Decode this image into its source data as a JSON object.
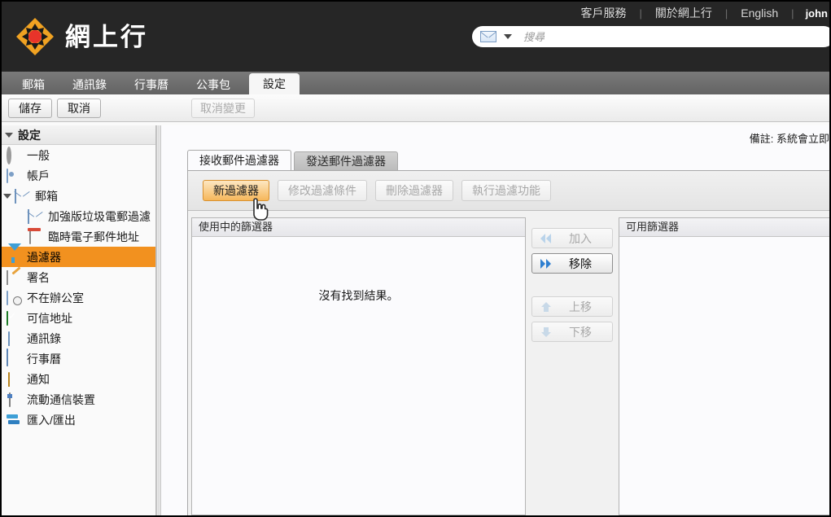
{
  "header": {
    "brand_name": "網上行",
    "util_links": [
      "客戶服務",
      "關於網上行",
      "English"
    ],
    "separator": "|",
    "user_name": "john",
    "search": {
      "placeholder": "搜尋",
      "value": "",
      "mail_icon": "envelope-icon",
      "dropdown_icon": "chevron-down-icon"
    }
  },
  "main_tabs": [
    {
      "label": "郵箱",
      "active": false
    },
    {
      "label": "通訊錄",
      "active": false
    },
    {
      "label": "行事曆",
      "active": false
    },
    {
      "label": "公事包",
      "active": false
    },
    {
      "label": "設定",
      "active": true
    }
  ],
  "toolbar": {
    "save_label": "儲存",
    "cancel_label": "取消",
    "revert_label": "取消變更"
  },
  "sidebar": {
    "section_title": "設定",
    "items": [
      {
        "label": "一般",
        "icon": "gear-icon",
        "indent": 0,
        "selected": false
      },
      {
        "label": "帳戶",
        "icon": "account-icon",
        "indent": 0,
        "selected": false
      },
      {
        "label": "郵箱",
        "icon": "envelope-icon",
        "indent": 0,
        "selected": false,
        "expander": true
      },
      {
        "label": "加強版垃圾電郵過濾",
        "icon": "envelope-icon",
        "indent": 2,
        "selected": false
      },
      {
        "label": "臨時電子郵件地址",
        "icon": "trash-icon",
        "indent": 2,
        "selected": false
      },
      {
        "label": "過濾器",
        "icon": "funnel-icon",
        "indent": 0,
        "selected": true
      },
      {
        "label": "署名",
        "icon": "signature-icon",
        "indent": 0,
        "selected": false
      },
      {
        "label": "不在辦公室",
        "icon": "out-of-office-icon",
        "indent": 0,
        "selected": false
      },
      {
        "label": "可信地址",
        "icon": "shield-check-icon",
        "indent": 0,
        "selected": false
      },
      {
        "label": "通訊錄",
        "icon": "person-icon",
        "indent": 0,
        "selected": false
      },
      {
        "label": "行事曆",
        "icon": "calendar-icon",
        "indent": 0,
        "selected": false
      },
      {
        "label": "通知",
        "icon": "bell-icon",
        "indent": 0,
        "selected": false
      },
      {
        "label": "流動通信裝置",
        "icon": "mobile-icon",
        "indent": 0,
        "selected": false
      },
      {
        "label": "匯入/匯出",
        "icon": "import-export-icon",
        "indent": 0,
        "selected": false
      }
    ]
  },
  "content": {
    "note": "備註: 系統會立即",
    "sub_tabs": [
      {
        "label": "接收郵件過濾器",
        "active": true
      },
      {
        "label": "發送郵件過濾器",
        "active": false
      }
    ],
    "panel_buttons": [
      {
        "label": "新過濾器",
        "state": "primary"
      },
      {
        "label": "修改過濾條件",
        "state": "disabled"
      },
      {
        "label": "刪除過濾器",
        "state": "disabled"
      },
      {
        "label": "執行過濾功能",
        "state": "disabled"
      }
    ],
    "active_list": {
      "header": "使用中的篩選器",
      "empty_message": "沒有找到結果。",
      "rows": []
    },
    "available_list": {
      "header": "可用篩選器",
      "rows": []
    },
    "transfer_buttons": [
      {
        "label": "加入",
        "icon": "double-chevron-left-icon",
        "enabled": false
      },
      {
        "label": "移除",
        "icon": "double-chevron-right-icon",
        "enabled": true
      },
      {
        "label": "上移",
        "icon": "arrow-up-icon",
        "enabled": false
      },
      {
        "label": "下移",
        "icon": "arrow-down-icon",
        "enabled": false
      }
    ]
  },
  "colors": {
    "header_bg": "#262626",
    "accent_orange": "#f2911f",
    "tabstrip_bg": "#6e6e6e",
    "selected_row": "#f2911f",
    "enabled_chevron": "#2f7fd0",
    "disabled_chevron": "#b9d3ea"
  }
}
